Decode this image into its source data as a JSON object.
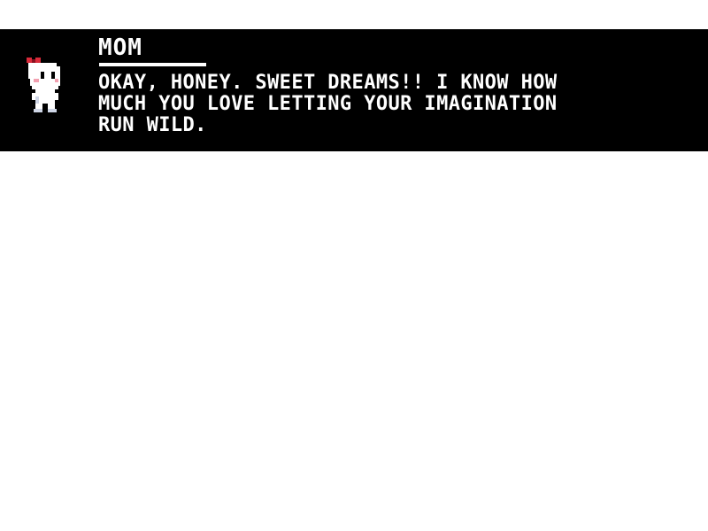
{
  "dialogue": {
    "speaker": "MOM",
    "lines": [
      "OKAY, HONEY. SWEET DREAMS!! I KNOW HOW",
      "MUCH YOU LOVE LETTING YOUR IMAGINATION",
      "RUN WILD."
    ],
    "portrait_icon": "child-bunny-with-red-bow-icon"
  },
  "colors": {
    "background": "#ffffff",
    "dialogue_box": "#000000",
    "text": "#ffffff",
    "bow_accent": "#d92a3a",
    "cheek_accent": "#f2a0b0"
  }
}
